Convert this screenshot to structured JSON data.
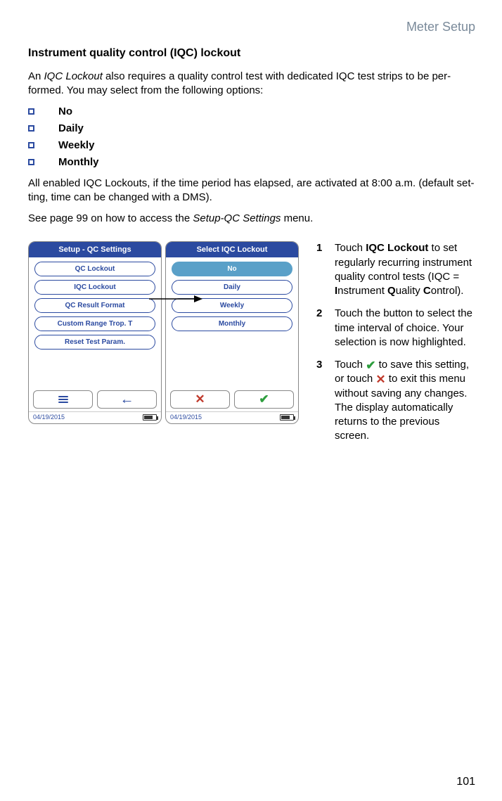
{
  "header": {
    "section": "Meter Setup"
  },
  "title": "Instrument quality control (IQC) lockout",
  "intro_a": "An ",
  "intro_em": "IQC Lockout",
  "intro_b": " also requires a quality control test with dedicated IQC test strips to be per­formed. You may select from the following options:",
  "options": [
    "No",
    "Daily",
    "Weekly",
    "Monthly"
  ],
  "para2": "All enabled IQC Lockouts, if the time period has elapsed, are activated at 8:00 a.m. (default set­ting, time can be changed with a DMS).",
  "para3_a": "See page 99 on how to access the ",
  "para3_em": "Setup-QC Settings",
  "para3_b": " menu.",
  "screens": {
    "left": {
      "title": "Setup - QC Settings",
      "items": [
        "QC Lockout",
        "IQC Lockout",
        "QC Result Format",
        "Custom Range Trop. T",
        "Reset Test Param."
      ],
      "date": "04/19/2015"
    },
    "right": {
      "title": "Select IQC Lockout",
      "items": [
        "No",
        "Daily",
        "Weekly",
        "Monthly"
      ],
      "selected": 0,
      "date": "04/19/2015"
    }
  },
  "steps": {
    "s1_a": "Touch ",
    "s1_b": "IQC Lockout",
    "s1_c": " to set regularly recur­ring instrument quality control tests (IQC = ",
    "s1_d": "I",
    "s1_e": "nstrument ",
    "s1_f": "Q",
    "s1_g": "uality ",
    "s1_h": "C",
    "s1_i": "ontrol).",
    "s2": "Touch the button to select the time interval of choice. Your selection is now high­lighted.",
    "s3_a": "Touch ",
    "s3_b": " to save this setting, or touch ",
    "s3_c": " to exit this menu without saving any changes. The display automatically returns to the previous screen."
  },
  "page_number": "101"
}
